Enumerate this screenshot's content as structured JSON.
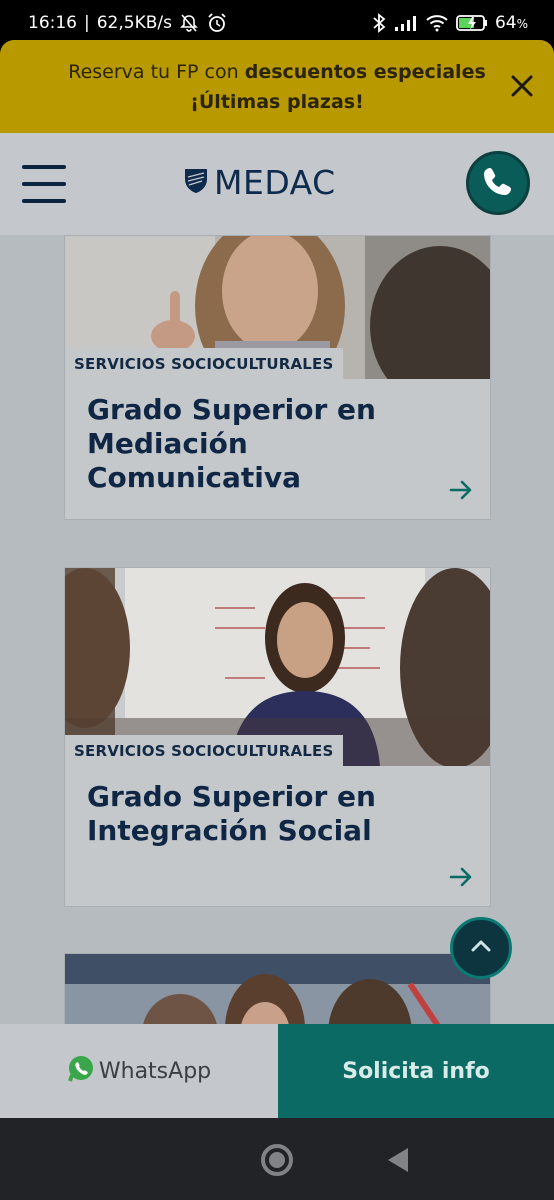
{
  "status_bar": {
    "time": "16:16",
    "speed": "62,5KB/s",
    "battery": "64",
    "battery_unit": "%",
    "icons": [
      "bell-off-icon",
      "alarm-icon",
      "bluetooth-icon",
      "signal-icon",
      "wifi-icon",
      "battery-charging-icon"
    ]
  },
  "promo": {
    "line1_a": "Reserva tu FP con ",
    "line1_b": "descuentos especiales",
    "line2": "¡Últimas plazas!",
    "close_icon": "close-icon"
  },
  "header": {
    "logo_text": "MEDAC",
    "menu_icon": "hamburger-menu-icon",
    "phone_icon": "phone-icon"
  },
  "cards": [
    {
      "category": "SERVICIOS SOCIOCULTURALES",
      "title_line1": "Grado Superior en",
      "title_line2": "Mediación Comunicativa",
      "arrow_icon": "arrow-right-icon"
    },
    {
      "category": "SERVICIOS SOCIOCULTURALES",
      "title_line1": "Grado Superior en",
      "title_line2": "Integración Social",
      "arrow_icon": "arrow-right-icon"
    }
  ],
  "scroll_top_icon": "chevron-up-icon",
  "cta": {
    "whatsapp_label": "WhatsApp",
    "info_label": "Solicita info"
  },
  "colors": {
    "promo_bg": "#b89a00",
    "brand_navy": "#0e2a4c",
    "accent_teal": "#0c6a64"
  }
}
